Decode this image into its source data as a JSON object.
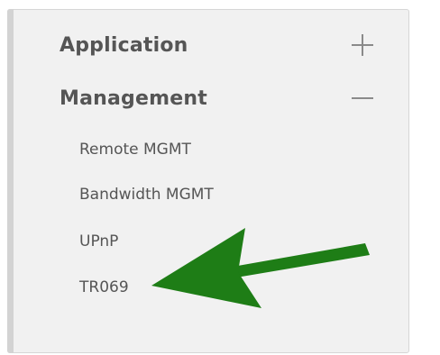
{
  "menu": {
    "sections": [
      {
        "label": "Application",
        "toggle": "plus-icon"
      },
      {
        "label": "Management",
        "toggle": "minus-icon"
      }
    ],
    "management_items": [
      {
        "label": "Remote MGMT"
      },
      {
        "label": "Bandwidth MGMT"
      },
      {
        "label": "UPnP"
      },
      {
        "label": "TR069"
      }
    ]
  },
  "annotation": {
    "arrow_color": "#1e7d16",
    "arrow_target": "TR069"
  },
  "colors": {
    "panel_bg": "#f1f1f1",
    "text": "#555555",
    "icon": "#8a8a8a"
  }
}
